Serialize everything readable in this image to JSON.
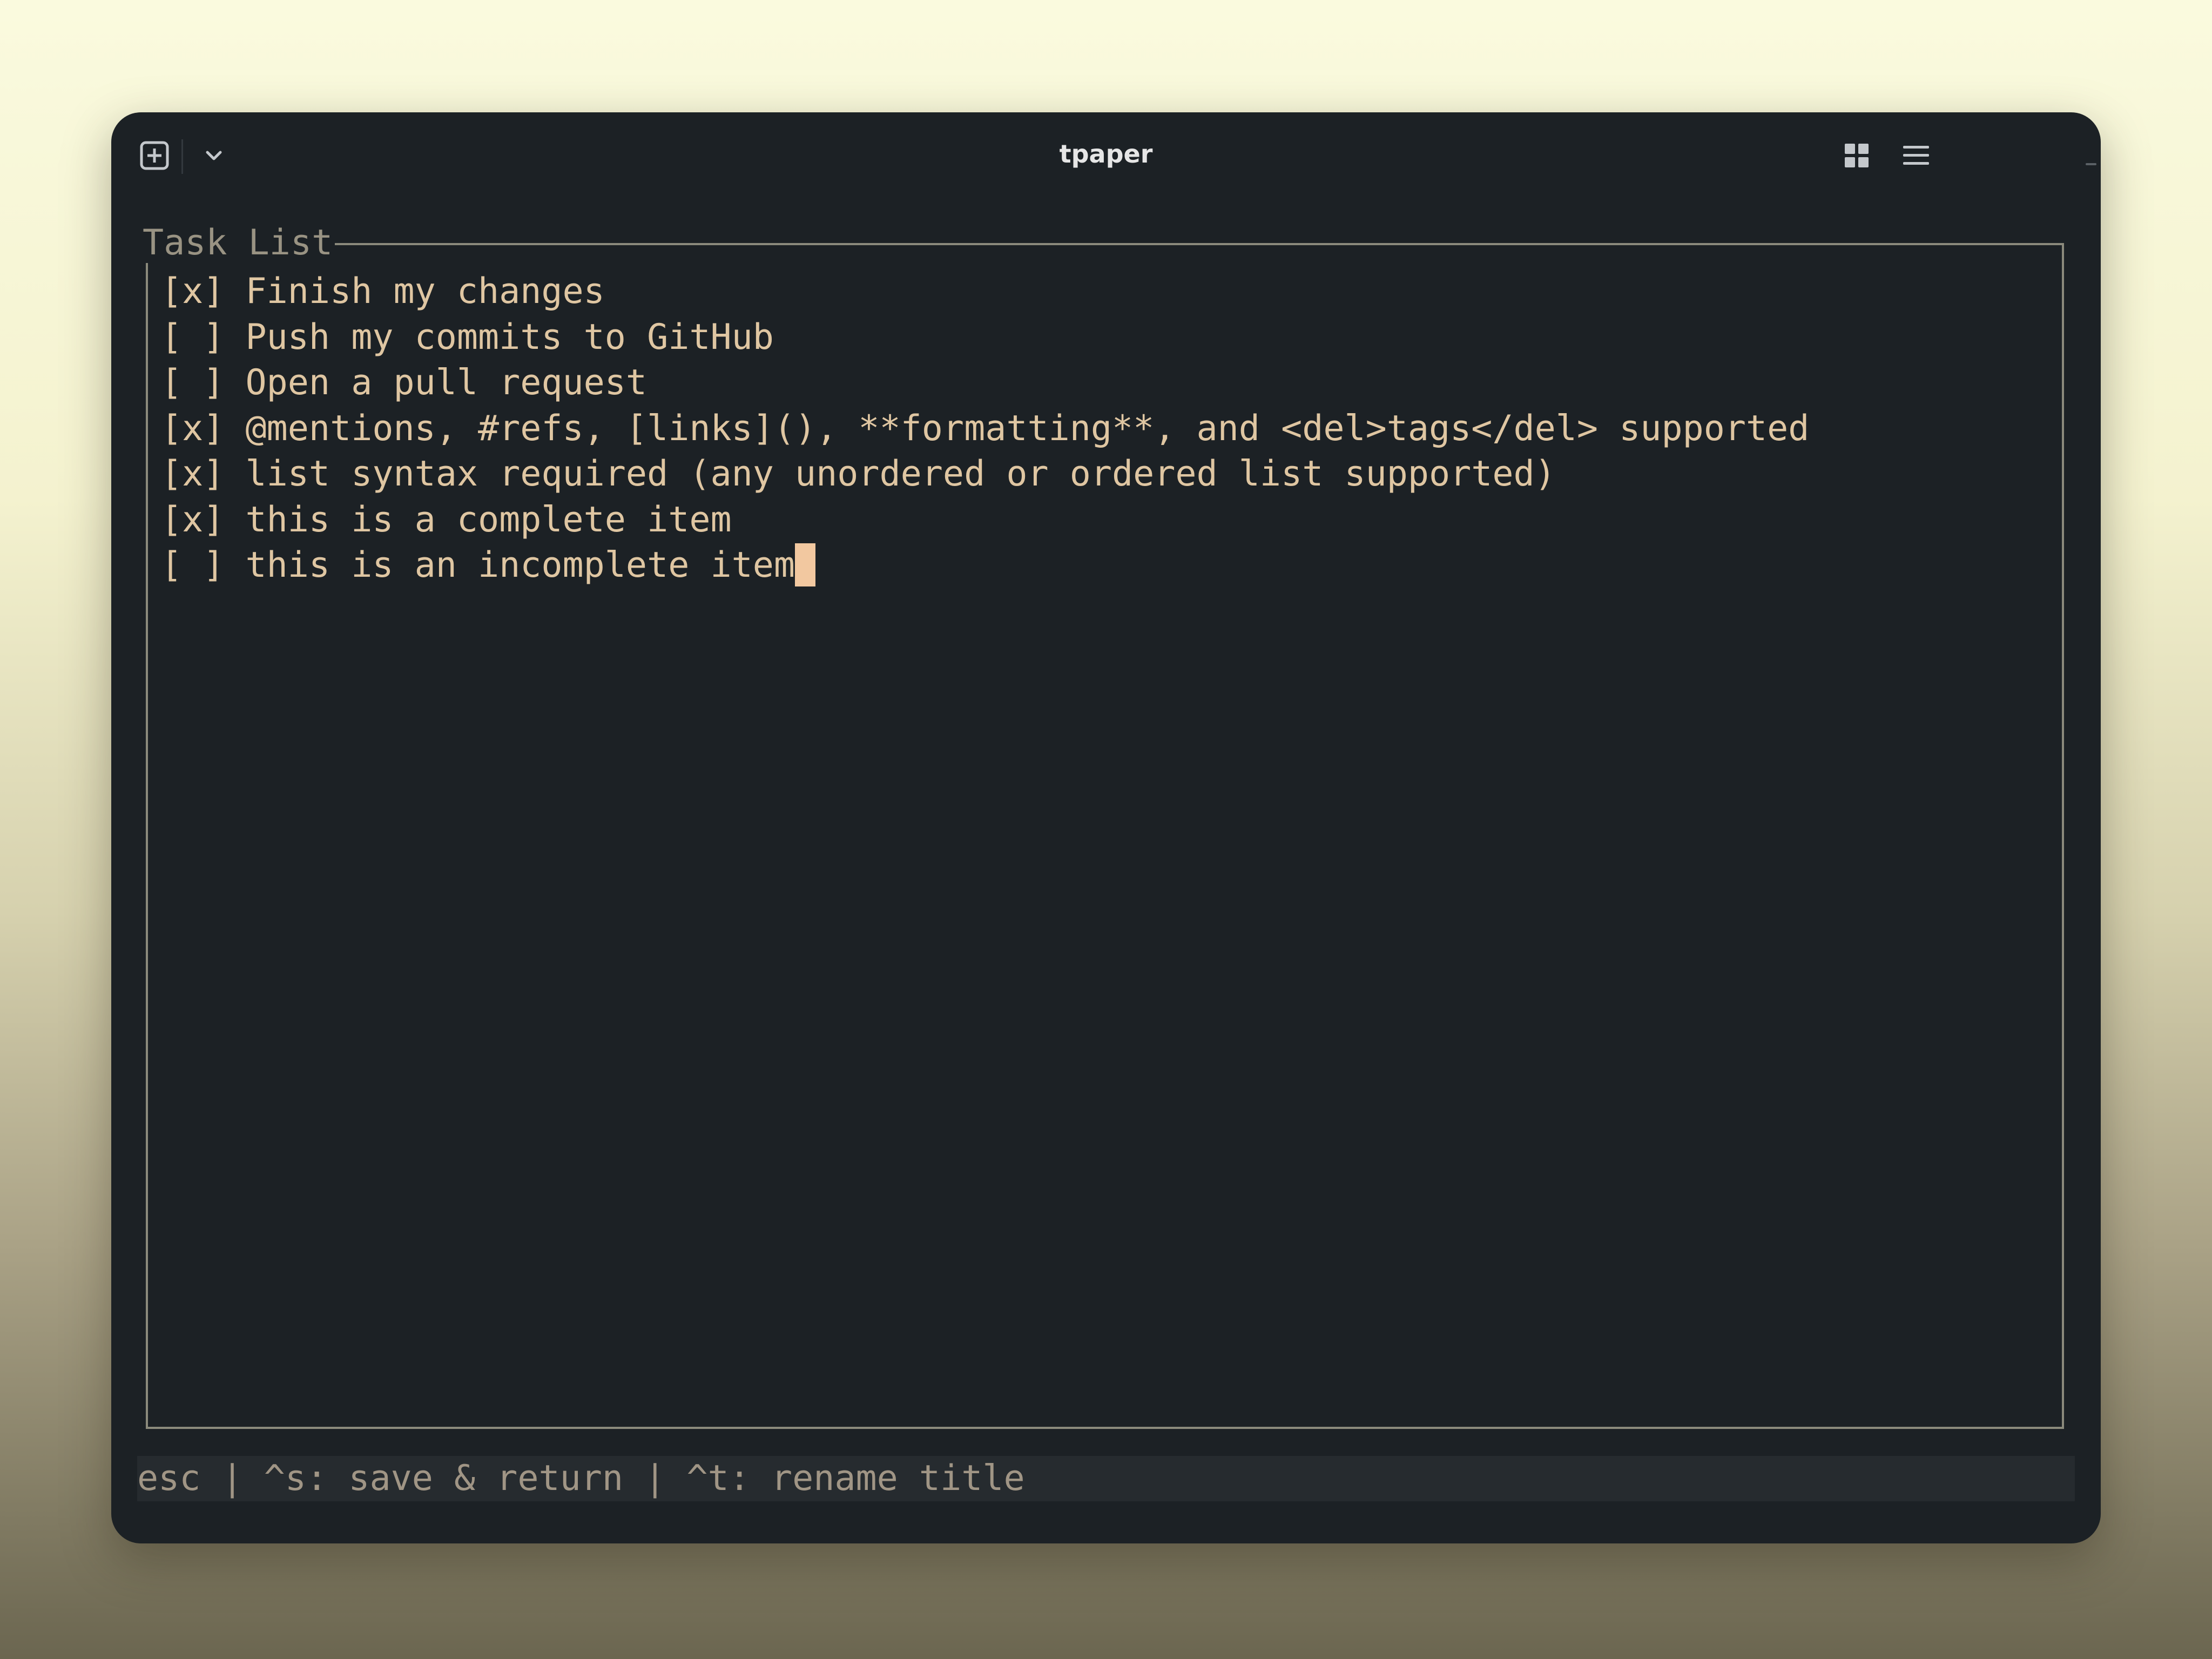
{
  "window": {
    "title": "tpaper"
  },
  "task_list": {
    "title": "Task List",
    "items": [
      {
        "text": "[x] Finish my changes"
      },
      {
        "text": "[ ] Push my commits to GitHub"
      },
      {
        "text": "[ ] Open a pull request"
      },
      {
        "text": "[x] @mentions, #refs, [links](), **formatting**, and <del>tags</del> supported"
      },
      {
        "text": "[x] list syntax required (any unordered or ordered list supported)"
      },
      {
        "text": "[x] this is a complete item"
      },
      {
        "text": "[ ] this is an incomplete item"
      }
    ]
  },
  "status_bar": {
    "text": "esc | ^s: save & return | ^t: rename title"
  },
  "icons": {
    "new_tab": "new-tab-icon",
    "dropdown": "chevron-down-icon",
    "grid": "grid-icon",
    "menu": "hamburger-menu-icon",
    "minimize": "minimize-icon",
    "maximize": "maximize-icon",
    "close": "close-icon"
  },
  "colors": {
    "text": "#dfc6a2",
    "cursor": "#f2c8a0",
    "background": "#1c2125",
    "border": "#8b8a7c"
  }
}
